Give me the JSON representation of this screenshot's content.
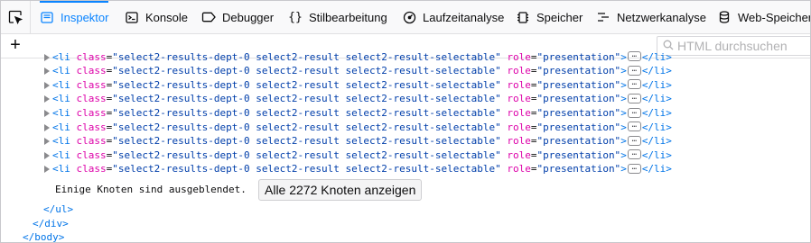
{
  "toolbar": {
    "tabs": [
      {
        "label": "Inspektor",
        "icon": "inspector-icon",
        "active": true
      },
      {
        "label": "Konsole",
        "icon": "console-icon"
      },
      {
        "label": "Debugger",
        "icon": "debugger-icon"
      },
      {
        "label": "Stilbearbeitung",
        "icon": "braces-icon"
      },
      {
        "label": "Laufzeitanalyse",
        "icon": "performance-icon"
      },
      {
        "label": "Speicher",
        "icon": "memory-icon"
      },
      {
        "label": "Netzwerkanalyse",
        "icon": "network-icon"
      },
      {
        "label": "Web-Speicher",
        "icon": "storage-icon"
      }
    ]
  },
  "search": {
    "placeholder": "HTML durchsuchen"
  },
  "markup": {
    "li_row": {
      "open_tag": "<li",
      "attr_class": "class",
      "class_value": "\"select2-results-dept-0 select2-result select2-result-selectable\"",
      "attr_role": "role",
      "role_value": "\"presentation\"",
      "gt": ">",
      "ellipsis": "…",
      "close_tag": "</li>"
    },
    "hidden_notice": "Einige Knoten sind ausgeblendet.",
    "show_all_button": "Alle 2272 Knoten anzeigen",
    "closing": [
      "</ul>",
      "</div>",
      "</body>"
    ]
  },
  "colors": {
    "accent": "#0a84ff",
    "tag": "#0074e8",
    "attribute": "#dd00a9",
    "value": "#003eaa"
  }
}
